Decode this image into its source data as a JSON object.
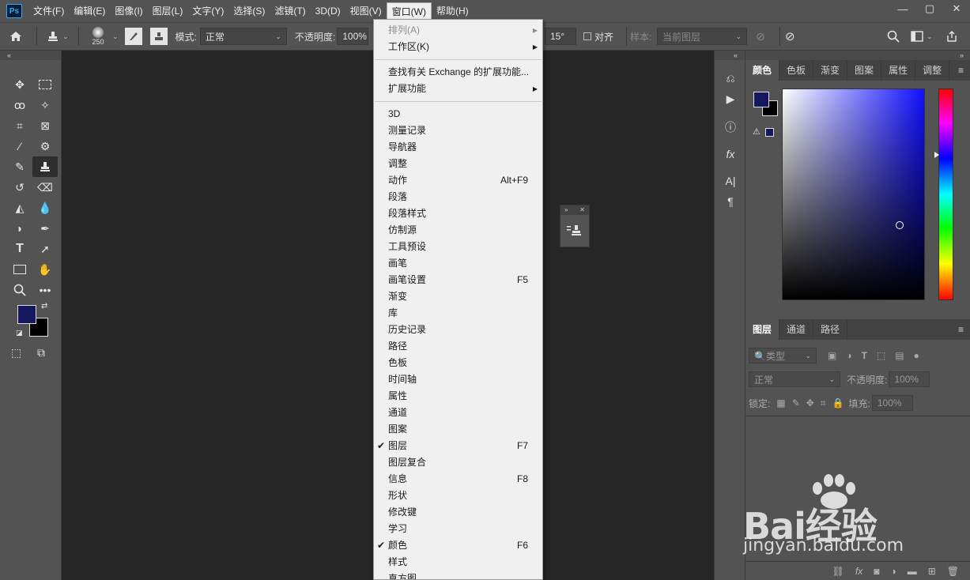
{
  "app": {
    "logo": "Ps"
  },
  "menubar": {
    "items": [
      "文件(F)",
      "编辑(E)",
      "图像(I)",
      "图层(L)",
      "文字(Y)",
      "选择(S)",
      "滤镜(T)",
      "3D(D)",
      "视图(V)",
      "窗口(W)",
      "帮助(H)"
    ],
    "active": "窗口(W)"
  },
  "window_controls": {
    "minimize": "—",
    "maximize": "▢",
    "close": "✕"
  },
  "options": {
    "brush_size": "250",
    "mode_label": "模式:",
    "mode_value": "正常",
    "opacity_label": "不透明度:",
    "opacity_value": "100%",
    "angle_value": "15°",
    "align_label": "对齐",
    "sample_label": "样本:",
    "sample_value": "当前图层"
  },
  "window_menu": [
    {
      "label": "排列(A)",
      "submenu": true,
      "disabled": true
    },
    {
      "label": "工作区(K)",
      "submenu": true
    },
    {
      "sep": true
    },
    {
      "label": "查找有关 Exchange 的扩展功能..."
    },
    {
      "label": "扩展功能",
      "submenu": true
    },
    {
      "sep": true
    },
    {
      "label": "3D"
    },
    {
      "label": "测量记录"
    },
    {
      "label": "导航器"
    },
    {
      "label": "调整"
    },
    {
      "label": "动作",
      "shortcut": "Alt+F9"
    },
    {
      "label": "段落"
    },
    {
      "label": "段落样式"
    },
    {
      "label": "仿制源"
    },
    {
      "label": "工具预设"
    },
    {
      "label": "画笔"
    },
    {
      "label": "画笔设置",
      "shortcut": "F5"
    },
    {
      "label": "渐变"
    },
    {
      "label": "库"
    },
    {
      "label": "历史记录"
    },
    {
      "label": "路径"
    },
    {
      "label": "色板"
    },
    {
      "label": "时间轴"
    },
    {
      "label": "属性"
    },
    {
      "label": "通道"
    },
    {
      "label": "图案"
    },
    {
      "label": "图层",
      "shortcut": "F7",
      "checked": true
    },
    {
      "label": "图层复合"
    },
    {
      "label": "信息",
      "shortcut": "F8"
    },
    {
      "label": "形状"
    },
    {
      "label": "修改键"
    },
    {
      "label": "学习"
    },
    {
      "label": "颜色",
      "shortcut": "F6",
      "checked": true
    },
    {
      "label": "样式"
    },
    {
      "label": "直方图"
    }
  ],
  "color_panel": {
    "tabs": [
      "颜色",
      "色板",
      "渐变",
      "图案",
      "属性",
      "调整"
    ],
    "active": "颜色",
    "foreground": "#151860",
    "background": "#000000"
  },
  "layers_panel": {
    "tabs": [
      "图层",
      "通道",
      "路径"
    ],
    "active": "图层",
    "filter_label": "类型",
    "blend_mode": "正常",
    "opacity_label": "不透明度:",
    "opacity_value": "100%",
    "lock_label": "锁定:",
    "fill_label": "填充:",
    "fill_value": "100%"
  },
  "watermark": {
    "logo": "Bai经验",
    "url": "jingyan.baidu.com"
  }
}
